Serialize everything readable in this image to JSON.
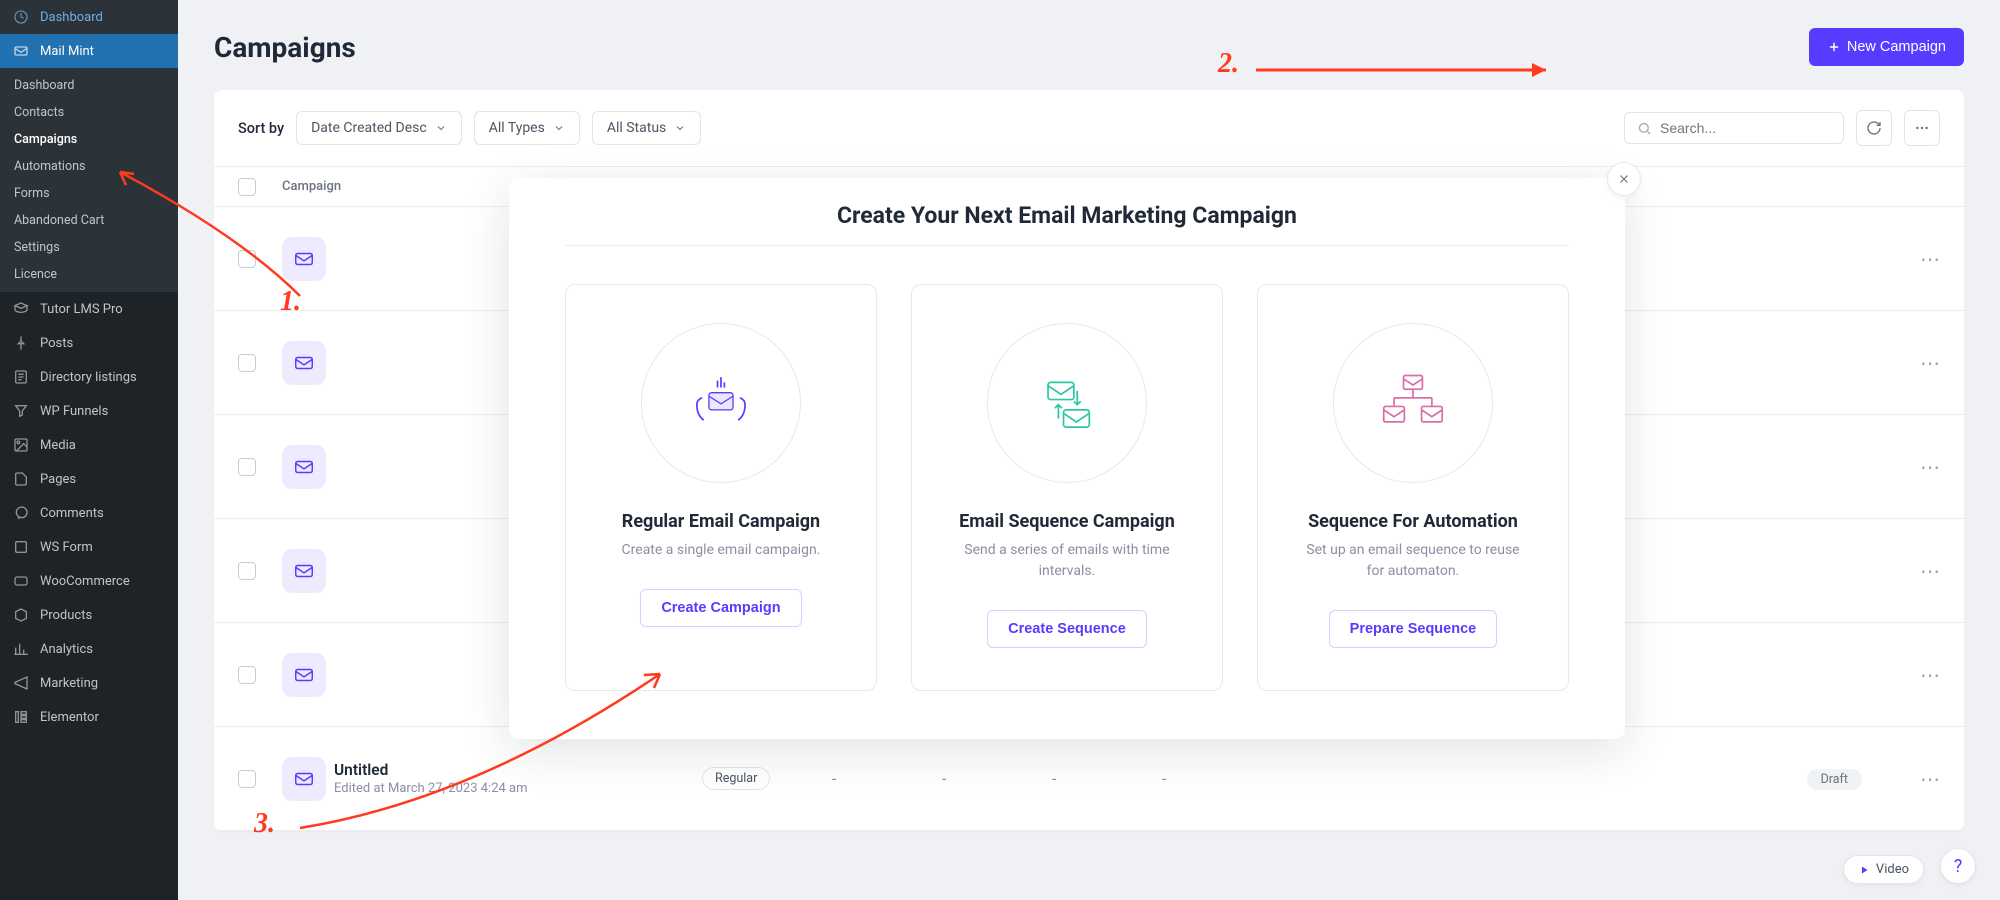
{
  "sidebar": {
    "wp_items_top": [
      {
        "label": "Dashboard",
        "icon": "dashboard-icon"
      }
    ],
    "active_parent": {
      "label": "Mail Mint",
      "icon": "mailmint-icon"
    },
    "mailmint_sub": [
      {
        "label": "Dashboard"
      },
      {
        "label": "Contacts"
      },
      {
        "label": "Campaigns",
        "active": true
      },
      {
        "label": "Automations"
      },
      {
        "label": "Forms"
      },
      {
        "label": "Abandoned Cart"
      },
      {
        "label": "Settings"
      },
      {
        "label": "Licence"
      }
    ],
    "wp_items_bottom": [
      {
        "label": "Tutor LMS Pro",
        "icon": "tutorlms-icon"
      },
      {
        "label": "Posts",
        "icon": "pin-icon"
      },
      {
        "label": "Directory listings",
        "icon": "directory-icon"
      },
      {
        "label": "WP Funnels",
        "icon": "wpfunnels-icon"
      },
      {
        "label": "Media",
        "icon": "media-icon"
      },
      {
        "label": "Pages",
        "icon": "page-icon"
      },
      {
        "label": "Comments",
        "icon": "comment-icon"
      },
      {
        "label": "WS Form",
        "icon": "wsform-icon"
      },
      {
        "label": "WooCommerce",
        "icon": "woo-icon"
      },
      {
        "label": "Products",
        "icon": "products-icon"
      },
      {
        "label": "Analytics",
        "icon": "analytics-icon"
      },
      {
        "label": "Marketing",
        "icon": "marketing-icon"
      },
      {
        "label": "Elementor",
        "icon": "elementor-icon"
      }
    ]
  },
  "header": {
    "title": "Campaigns",
    "new_btn": "New Campaign"
  },
  "toolbar": {
    "sort_label": "Sort by",
    "sort_value": "Date Created Desc",
    "type_value": "All Types",
    "status_value": "All Status",
    "search_placeholder": "Search..."
  },
  "table": {
    "col_campaign": "Campaign"
  },
  "rows": [
    {
      "title": "Untitled",
      "date": "Edited at March 27, 2023 4:24 am",
      "type": "Regular",
      "status": "Draft"
    }
  ],
  "modal": {
    "title": "Create Your Next Email Marketing Campaign",
    "options": [
      {
        "title": "Regular Email Campaign",
        "desc": "Create a single email campaign.",
        "btn": "Create Campaign",
        "illus": "regular-illus"
      },
      {
        "title": "Email Sequence Campaign",
        "desc": "Send a series of emails with time intervals.",
        "btn": "Create Sequence",
        "illus": "sequence-illus"
      },
      {
        "title": "Sequence For Automation",
        "desc": "Set up an email sequence to reuse for automaton.",
        "btn": "Prepare Sequence",
        "illus": "automation-illus"
      }
    ]
  },
  "annotations": {
    "one": "1.",
    "two": "2.",
    "three": "3."
  },
  "footer": {
    "video": "Video",
    "help": "?"
  }
}
